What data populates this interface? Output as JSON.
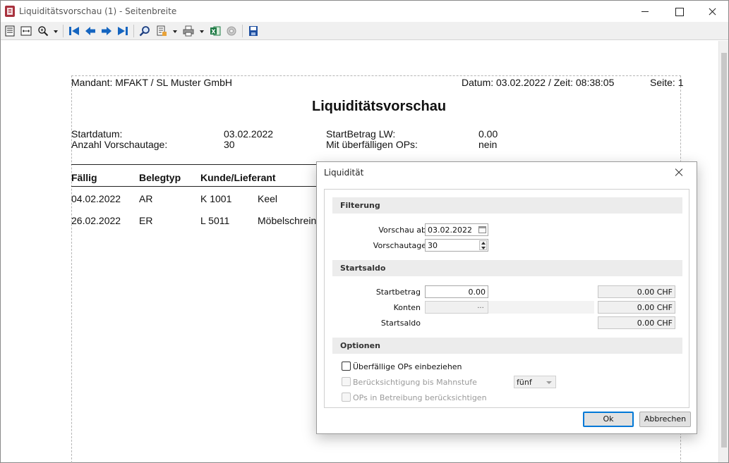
{
  "window": {
    "title": "Liquiditätsvorschau (1) - Seitenbreite"
  },
  "toolbar": {
    "icons": [
      "single-page-icon",
      "page-width-icon",
      "zoom-icon",
      "first-page-icon",
      "previous-page-icon",
      "next-page-icon",
      "last-page-icon",
      "search-icon",
      "export-document-icon",
      "print-icon",
      "excel-icon",
      "gear-icon",
      "save-icon"
    ]
  },
  "report": {
    "mandant": "Mandant: MFAKT / SL Muster GmbH",
    "datum": "Datum: 03.02.2022 / Zeit: 08:38:05",
    "seite": "Seite: 1",
    "title": "Liquiditätsvorschau",
    "startdatum_label": "Startdatum:",
    "startdatum_value": "03.02.2022",
    "anzahl_label": "Anzahl Vorschautage:",
    "anzahl_value": "30",
    "startbetrag_label": "StartBetrag LW:",
    "startbetrag_value": "0.00",
    "ueberfaellig_label": "Mit überfälligen OPs:",
    "ueberfaellig_value": "nein",
    "columns": [
      "Fällig",
      "Belegtyp",
      "Kunde/Lieferant"
    ],
    "rows": [
      {
        "faellig": "04.02.2022",
        "belegtyp": "AR",
        "nr": "K 1001",
        "name": "Keel"
      },
      {
        "faellig": "26.02.2022",
        "belegtyp": "ER",
        "nr": "L 5011",
        "name": "Möbelschreine"
      }
    ]
  },
  "dialog": {
    "title": "Liquidität",
    "filterung": {
      "header": "Filterung",
      "vorschau_ab_label": "Vorschau ab",
      "vorschau_ab_value": "03.02.2022",
      "vorschautage_label": "Vorschautage",
      "vorschautage_value": "30"
    },
    "startsaldo": {
      "header": "Startsaldo",
      "startbetrag_label": "Startbetrag",
      "startbetrag_value": "0.00",
      "startbetrag_chf": "0.00 CHF",
      "konten_label": "Konten",
      "konten_value": "",
      "konten_button": "...",
      "konten_chf": "0.00 CHF",
      "startsaldo_label": "Startsaldo",
      "startsaldo_chf": "0.00 CHF"
    },
    "optionen": {
      "header": "Optionen",
      "ueberfaellige_label": "Überfällige OPs einbeziehen",
      "mahnstufe_label": "Berücksichtigung bis Mahnstufe",
      "mahnstufe_value": "fünf",
      "betreibung_label": "OPs in Betreibung berücksichtigen"
    },
    "ok_label": "Ok",
    "cancel_label": "Abbrechen"
  }
}
